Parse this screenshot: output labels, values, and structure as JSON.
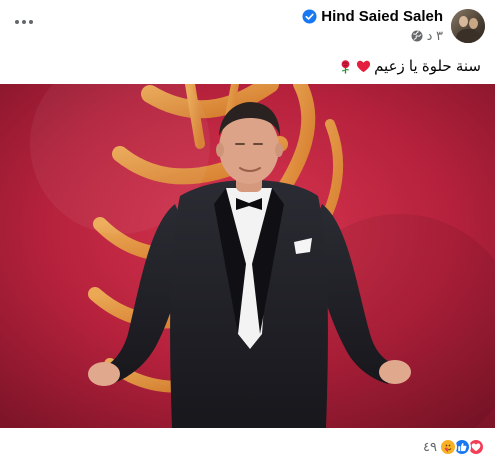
{
  "post": {
    "author": "Hind Saied Saleh",
    "verified_icon": "verified-badge-icon",
    "timestamp": "٣ د",
    "audience_icon": "globe-icon",
    "more_icon": "more-options-icon",
    "caption_text": "سنة حلوة يا زعيم",
    "caption_emojis": [
      "heart-icon",
      "rose-icon"
    ],
    "photo_description_icon": "post-photo"
  },
  "reactions": {
    "types": [
      "love",
      "like",
      "care"
    ],
    "count": "٤٩"
  },
  "colors": {
    "text_primary": "#050505",
    "text_secondary": "#65676b",
    "like_blue": "#1877f2",
    "love_red": "#f33e58",
    "care_yellow": "#f7b125",
    "photo_backdrop": "#b21f3a"
  }
}
